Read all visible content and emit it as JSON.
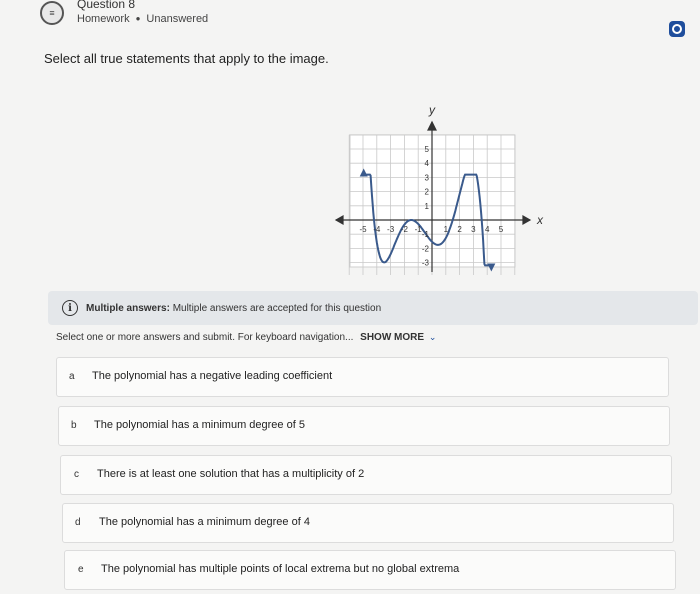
{
  "header": {
    "question_title": "Question 8",
    "category": "Homework",
    "status": "Unanswered",
    "icon_name": "list-icon",
    "corner_icon_name": "record-icon",
    "accent_color": "#1f4e9c"
  },
  "prompt": "Select all true statements that apply to the image.",
  "graph": {
    "y_label": "y",
    "x_label": "x",
    "y_ticks": [
      "5",
      "4",
      "3",
      "2",
      "1",
      "-1",
      "-2",
      "-3"
    ],
    "x_ticks": [
      "-5",
      "-4",
      "-3",
      "-2",
      "-1",
      "1",
      "2",
      "3",
      "4",
      "5"
    ],
    "x_range": [
      -6,
      6
    ],
    "y_range": [
      -4,
      6
    ]
  },
  "info_bar": {
    "icon_name": "info-icon",
    "label": "Multiple answers:",
    "text": "Multiple answers are accepted for this question"
  },
  "instructions": {
    "text": "Select one or more answers and submit. For keyboard navigation...",
    "show_more": "SHOW MORE",
    "chevron_icon_name": "chevron-down-icon"
  },
  "options": [
    {
      "letter": "a",
      "text": "The polynomial has a negative leading coefficient"
    },
    {
      "letter": "b",
      "text": "The polynomial has a minimum degree of 5"
    },
    {
      "letter": "c",
      "text": "There is at least one solution that has a multiplicity of 2"
    },
    {
      "letter": "d",
      "text": "The polynomial has a minimum degree of 4"
    },
    {
      "letter": "e",
      "text": "The polynomial has multiple points of local extrema but no global extrema"
    }
  ]
}
